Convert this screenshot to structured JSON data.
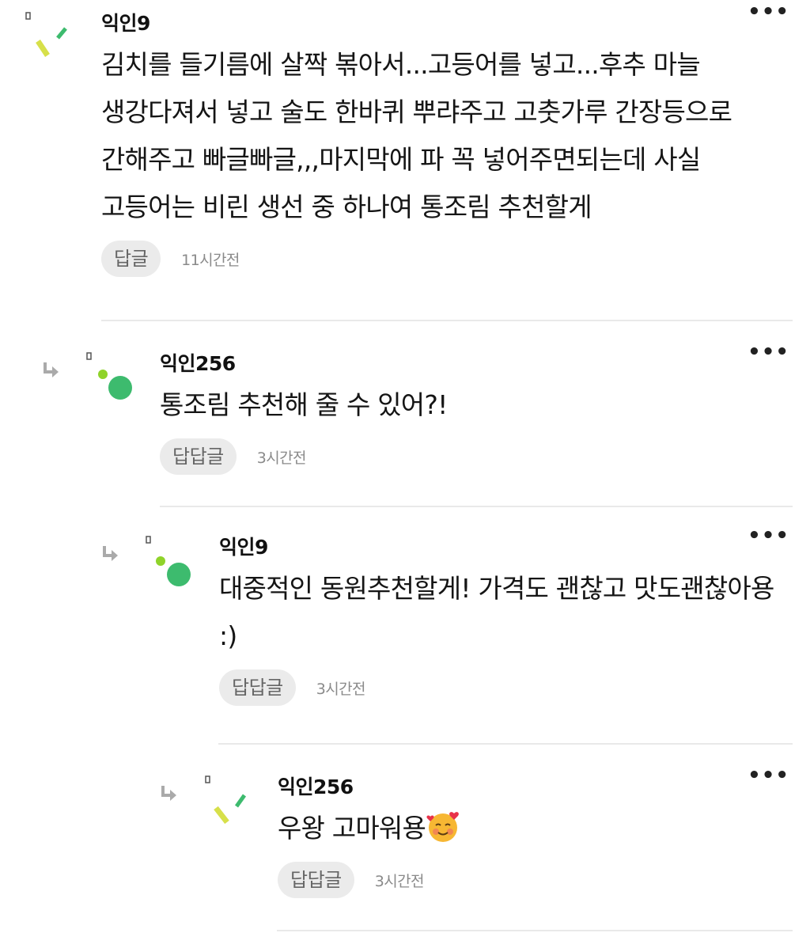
{
  "comments": [
    {
      "author": "익인9",
      "text": "김치를 들기름에 살짝 볶아서...고등어를 넣고...후추 마늘 생강다져서 넣고 술도 한바퀴 뿌랴주고 고춧가루 간장등으로 간해주고 빠글빠글,,,마지막에 파 꼭 넣어주면되는데 사실 고등어는 비린 생선 중 하나여 통조림 추천할게",
      "reply_label": "답글",
      "time": "11시간전",
      "more": "•••",
      "avatar_icon": "dash-avatar-icon"
    },
    {
      "author": "익인256",
      "text": "통조림 추천해 줄 수 있어?!",
      "reply_label": "답답글",
      "time": "3시간전",
      "more": "•••",
      "avatar_icon": "dot-avatar-icon"
    },
    {
      "author": "익인9",
      "text": "대중적인 동원추천할게! 가격도 괜찮고 맛도괜찮아용 :)",
      "reply_label": "답답글",
      "time": "3시간전",
      "more": "•••",
      "avatar_icon": "dot-avatar-icon"
    },
    {
      "author": "익인256",
      "text": "우왕 고마워용",
      "reply_label": "답답글",
      "time": "3시간전",
      "more": "•••",
      "avatar_icon": "dash-avatar-icon",
      "emoji_icon": "smiling-face-with-hearts-icon"
    }
  ],
  "colors": {
    "avatar_green": "#3dbb6e",
    "avatar_lime": "#8fd32a",
    "avatar_yellow": "#d7e04a",
    "reply_bg": "#ebebeb",
    "divider": "#e9e9e9"
  }
}
